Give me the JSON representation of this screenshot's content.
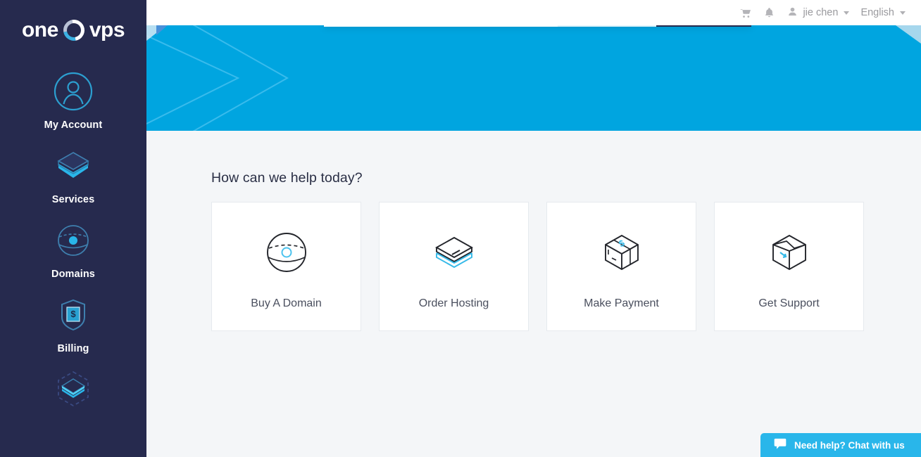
{
  "brand": {
    "logo_left": "one",
    "logo_right": "vps",
    "logo_mark": "ring-icon",
    "accent_blue": "#00a5e0",
    "accent_cyan": "#29b6ea",
    "navy": "#262a4e"
  },
  "sidebar": {
    "items": [
      {
        "label": "My Account",
        "icon": "user-circle-icon"
      },
      {
        "label": "Services",
        "icon": "layers-box-icon"
      },
      {
        "label": "Domains",
        "icon": "globe-icon"
      },
      {
        "label": "Billing",
        "icon": "shield-dollar-icon"
      },
      {
        "label": "",
        "icon": "network-layers-icon"
      }
    ]
  },
  "topbar": {
    "cart_icon": "cart-icon",
    "bell_icon": "bell-icon",
    "avatar_icon": "user-avatar-icon",
    "user_name": "jie chen",
    "language": "English"
  },
  "search": {
    "placeholder": "",
    "value": "",
    "tld_label": "",
    "button_label": ""
  },
  "main": {
    "title": "How can we help today?",
    "cards": [
      {
        "label": "Buy A Domain",
        "icon": "domain-sphere-icon"
      },
      {
        "label": "Order Hosting",
        "icon": "hosting-stack-icon"
      },
      {
        "label": "Make Payment",
        "icon": "payment-box-icon"
      },
      {
        "label": "Get Support",
        "icon": "support-open-box-icon"
      }
    ]
  },
  "chat": {
    "label": "Need help? Chat with us",
    "icon": "chat-bubble-icon"
  }
}
